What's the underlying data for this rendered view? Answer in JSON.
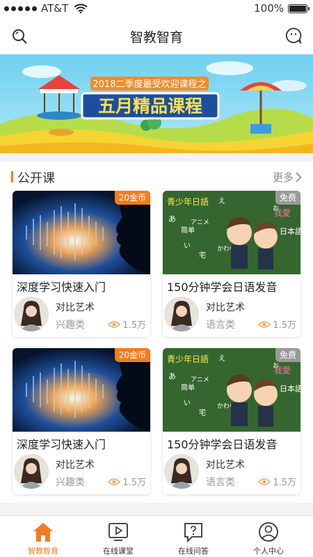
{
  "status_bar": {
    "carrier": "AT&T",
    "battery": "100%"
  },
  "header": {
    "title": "智教智育"
  },
  "banner": {
    "subtitle": "2018二季度最受欢迎课程之",
    "headline": "五月精品课程"
  },
  "section": {
    "title": "公开课",
    "more_label": "更多"
  },
  "courses": [
    {
      "title": "深度学习快速入门",
      "badge": "20金币",
      "teacher": "对比艺术",
      "category": "兴趣类",
      "views": "1.5万"
    },
    {
      "title": "150分钟学会日语发音",
      "badge": "免费",
      "teacher": "对比艺术",
      "category": "语言类",
      "views": "1.5万"
    },
    {
      "title": "深度学习快速入门",
      "badge": "20金币",
      "teacher": "对比艺术",
      "category": "兴趣类",
      "views": "1.5万"
    },
    {
      "title": "150分钟学会日语发音",
      "badge": "免费",
      "teacher": "对比艺术",
      "category": "语言类",
      "views": "1.5万"
    }
  ],
  "thumb_text": {
    "chalk_title": "青少年日語",
    "chalk_love": "我愛",
    "chalk_jp": "日本語",
    "chalk_simple": "简单",
    "chalk_anime": "アニメ",
    "chalk_kawaii": "かわいい",
    "chalk_i": "い",
    "chalk_zhai": "宅",
    "chalk_o": "お",
    "chalk_e": "え",
    "chalk_a": "あ"
  },
  "tabs": [
    {
      "label": "智教智育",
      "active": true
    },
    {
      "label": "在线课堂",
      "active": false
    },
    {
      "label": "在线问答",
      "active": false
    },
    {
      "label": "个人中心",
      "active": false
    }
  ],
  "colors": {
    "accent": "#f47c20",
    "free_badge": "#9a9a9a"
  }
}
